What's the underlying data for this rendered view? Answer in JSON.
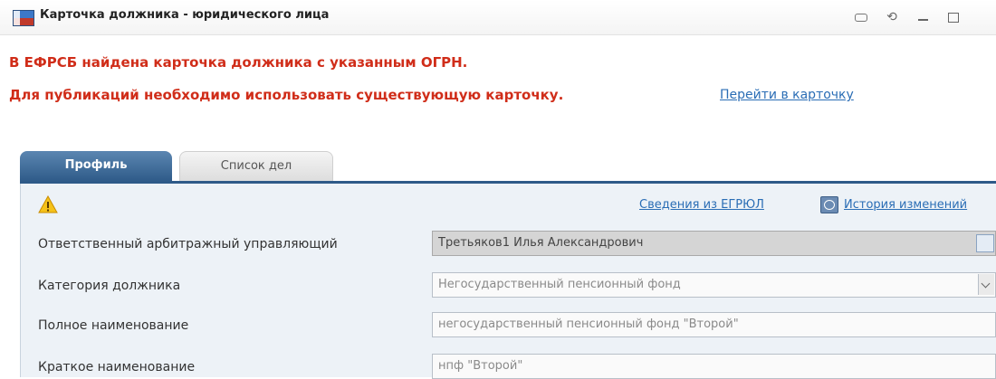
{
  "window": {
    "title": "Карточка должника - юридического лица",
    "icon": "app-window-icon",
    "controls": [
      "pin-icon",
      "refresh-icon",
      "minimize-icon",
      "maximize-icon"
    ]
  },
  "alerts": {
    "line1": "В ЕФРСБ найдена карточка должника с указанным ОГРН.",
    "line2": "Для публикаций необходимо использовать существующую карточку.",
    "link": "Перейти в карточку",
    "color": "#d02d19"
  },
  "tabs": [
    {
      "label": "Профиль",
      "active": true
    },
    {
      "label": "Список дел",
      "active": false
    }
  ],
  "panel": {
    "warning_icon": "warning-icon",
    "links": {
      "egrul": "Сведения из ЕГРЮЛ",
      "history": "История изменений"
    }
  },
  "fields": [
    {
      "label": "Ответственный арбитражный управляющий",
      "value": "Третьяков1 Илья Александрович"
    },
    {
      "label": "Категория должника",
      "value": "Негосударственный пенсионный фонд"
    },
    {
      "label": "Полное наименование",
      "value": "негосударственный пенсионный фонд \"Второй\""
    },
    {
      "label": "Краткое наименование",
      "value": "нпф \"Второй\""
    }
  ],
  "colors": {
    "accent": "#2e5a88",
    "link": "#2a6db5",
    "panel_bg": "#edf2f7"
  }
}
